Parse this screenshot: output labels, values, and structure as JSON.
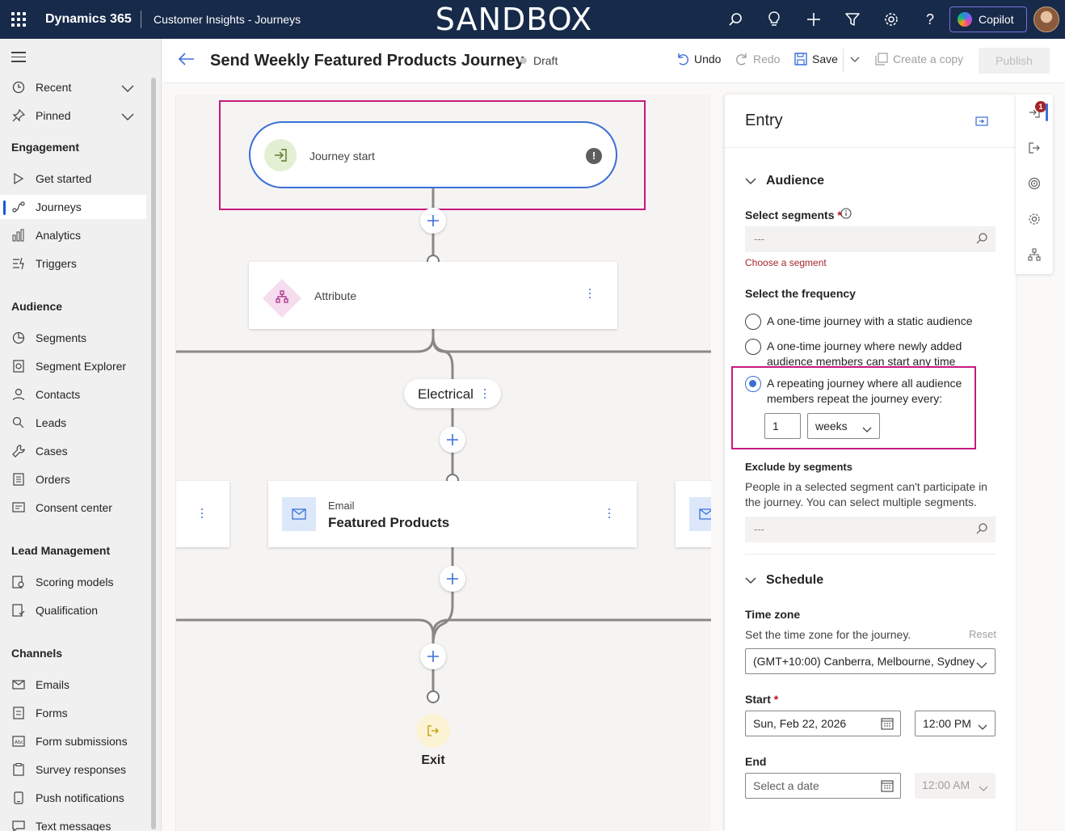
{
  "topbar": {
    "brand": "Dynamics 365",
    "app_name": "Customer Insights - Journeys",
    "environment_banner": "SANDBOX",
    "copilot_label": "Copilot",
    "icons": [
      "waffle-icon",
      "search-icon",
      "lightbulb-icon",
      "plus-icon",
      "filter-icon",
      "settings-icon",
      "help-icon",
      "copilot-icon",
      "avatar"
    ]
  },
  "leftnav": {
    "top_items": [
      {
        "label": "Recent",
        "icon": "clock-icon"
      },
      {
        "label": "Pinned",
        "icon": "pin-icon"
      }
    ],
    "groups": [
      {
        "title": "Engagement",
        "items": [
          {
            "label": "Get started",
            "icon": "play-icon"
          },
          {
            "label": "Journeys",
            "icon": "journey-icon",
            "active": true
          },
          {
            "label": "Analytics",
            "icon": "analytics-icon"
          },
          {
            "label": "Triggers",
            "icon": "trigger-icon"
          }
        ]
      },
      {
        "title": "Audience",
        "items": [
          {
            "label": "Segments",
            "icon": "segments-icon"
          },
          {
            "label": "Segment Explorer",
            "icon": "segment-explorer-icon"
          },
          {
            "label": "Contacts",
            "icon": "contact-icon"
          },
          {
            "label": "Leads",
            "icon": "leads-icon"
          },
          {
            "label": "Cases",
            "icon": "wrench-icon"
          },
          {
            "label": "Orders",
            "icon": "document-icon"
          },
          {
            "label": "Consent center",
            "icon": "consent-icon"
          }
        ]
      },
      {
        "title": "Lead Management",
        "items": [
          {
            "label": "Scoring models",
            "icon": "scoring-icon"
          },
          {
            "label": "Qualification",
            "icon": "qualification-icon"
          }
        ]
      },
      {
        "title": "Channels",
        "items": [
          {
            "label": "Emails",
            "icon": "mail-icon"
          },
          {
            "label": "Forms",
            "icon": "form-icon"
          },
          {
            "label": "Form submissions",
            "icon": "form-submission-icon"
          },
          {
            "label": "Survey responses",
            "icon": "survey-icon"
          },
          {
            "label": "Push notifications",
            "icon": "push-notification-icon"
          },
          {
            "label": "Text messages",
            "icon": "text-message-icon"
          }
        ]
      }
    ]
  },
  "header": {
    "title": "Send Weekly Featured Products Journey",
    "status": "Draft",
    "undo": "Undo",
    "redo": "Redo",
    "save": "Save",
    "create_copy": "Create a copy",
    "publish": "Publish"
  },
  "canvas": {
    "start_label": "Journey start",
    "attribute_label": "Attribute",
    "branch_label": "Electrical",
    "email_type": "Email",
    "email_name": "Featured Products",
    "exit_label": "Exit",
    "highlight_color": "#c7197f"
  },
  "panel": {
    "title": "Entry",
    "audience_section": "Audience",
    "select_segments_label": "Select segments",
    "segments_placeholder": "---",
    "segments_error": "Choose a segment",
    "frequency_label": "Select the frequency",
    "frequency_options": [
      {
        "label": "A one-time journey with a static audience",
        "selected": false
      },
      {
        "label": "A one-time journey where newly added audience members can start any time",
        "selected": false
      },
      {
        "label": "A repeating journey where all audience members repeat the journey every:",
        "selected": true
      }
    ],
    "repeat_interval": "1",
    "repeat_unit": "weeks",
    "exclude_label": "Exclude by segments",
    "exclude_help": "People in a selected segment can't participate in the journey. You can select multiple segments.",
    "exclude_placeholder": "---",
    "schedule_section": "Schedule",
    "timezone_label": "Time zone",
    "timezone_help": "Set the time zone for the journey.",
    "reset": "Reset",
    "timezone_value": "(GMT+10:00) Canberra, Melbourne, Sydney",
    "start_label": "Start",
    "start_date": "Sun, Feb 22, 2026",
    "start_time": "12:00 PM",
    "end_label": "End",
    "end_date_placeholder": "Select a date",
    "end_time": "12:00 AM"
  },
  "rail": {
    "badge_count": "1",
    "icons": [
      "entry-icon",
      "exit-icon",
      "goal-icon",
      "settings-icon",
      "hierarchy-icon"
    ]
  },
  "colors": {
    "topbar_bg": "#172a4a",
    "accent": "#3b6fd8",
    "highlight": "#c7197f",
    "error": "#a4262c"
  }
}
